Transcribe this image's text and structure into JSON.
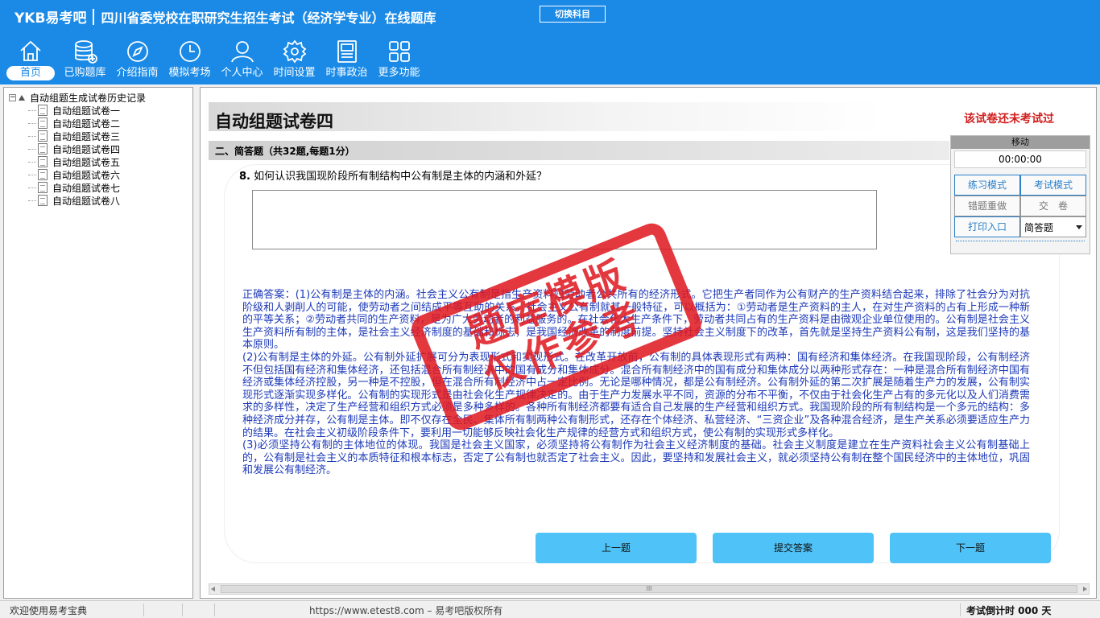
{
  "header": {
    "brand": "YKB易考吧",
    "title": "四川省委党校在职研究生招生考试（经济学专业）在线题库",
    "switch_subject": "切换科目"
  },
  "nav": [
    {
      "label": "首页",
      "icon": "home-icon",
      "active": true
    },
    {
      "label": "已购题库",
      "icon": "database-icon"
    },
    {
      "label": "介绍指南",
      "icon": "compass-icon"
    },
    {
      "label": "模拟考场",
      "icon": "clock-icon"
    },
    {
      "label": "个人中心",
      "icon": "user-icon"
    },
    {
      "label": "时间设置",
      "icon": "gear-icon"
    },
    {
      "label": "时事政治",
      "icon": "document-icon"
    },
    {
      "label": "更多功能",
      "icon": "grid-icon"
    }
  ],
  "sidebar": {
    "root": "自动组题生成试卷历史记录",
    "items": [
      "自动组题试卷一",
      "自动组题试卷二",
      "自动组题试卷三",
      "自动组题试卷四",
      "自动组题试卷五",
      "自动组题试卷六",
      "自动组题试卷七",
      "自动组题试卷八"
    ]
  },
  "paper": {
    "title": "自动组题试卷四",
    "status": "该试卷还未考试过",
    "section": "二、简答题（共32题,每题1分）",
    "question_number": "8.",
    "question": "如何认识我国现阶段所有制结构中公有制是主体的内涵和外延？",
    "answer": [
      "正确答案：(1)公有制是主体的内涵。社会主义公有制是指生产资料归劳动者公共所有的经济形式。它把生产者同作为公有财产的生产资料结合起来，排除了社会分为对抗阶级和人剥削人的可能，使劳动者之间结成平等互助的关系。社会主义公有制就其一般特征，可以概括为：①劳动者是生产资料的主人，在对生产资料的占有上形成一种新的平等关系；②劳动者共同的生产资料，是为广大劳动者的利益服务的。在社会化大生产条件下，劳动者共同占有的生产资料是由微观企业单位使用的。公有制是社会主义生产资料所有制的主体，是社会主义经济制度的基础和标志，是我国经济改革的制度前提。坚持社会主义制度下的改革，首先就是坚持生产资料公有制，这是我们坚持的基本原则。",
      "(2)公有制是主体的外延。公有制外延扩展可分为表现形式和实现形式。在改革开放前，公有制的具体表现形式有两种：国有经济和集体经济。在我国现阶段，公有制经济不但包括国有经济和集体经济，还包括混合所有制经济中的国有成分和集体成分。混合所有制经济中的国有成分和集体成分以两种形式存在：一种是混合所有制经济中国有经济或集体经济控股，另一种是不控股，但在混合所有制经济中占一定比例。无论是哪种情况，都是公有制经济。公有制外延的第二次扩展是随着生产力的发展，公有制实现形式逐渐实现多样化。公有制的实现形式是由社会化生产规律决定的。由于生产力发展水平不同，资源的分布不平衡，不仅由于社会化生产占有的多元化以及人们消费需求的多样性，决定了生产经营和组织方式必须是多种多样的。各种所有制经济都要有适合自己发展的生产经营和组织方式。我国现阶段的所有制结构是一个多元的结构：多种经济成分并存，公有制是主体。即不仅存在全民、集体所有制两种公有制形式，还存在个体经济、私营经济、“三资企业”及各种混合经济，是生产关系必须要适应生产力的结果。在社会主义初级阶段条件下，要利用一切能够反映社会化生产规律的经营方式和组织方式，使公有制的实现形式多样化。",
      "(3)必须坚持公有制的主体地位的体现。我国是社会主义国家，必须坚持将公有制作为社会主义经济制度的基础。社会主义制度是建立在生产资料社会主义公有制基础上的，公有制是社会主义的本质特征和根本标志，否定了公有制也就否定了社会主义。因此，要坚持和发展社会主义，就必须坚持公有制在整个国民经济中的主体地位，巩固和发展公有制经济。"
    ],
    "prev": "上一题",
    "submit": "提交答案",
    "next": "下一题"
  },
  "control": {
    "move": "移动",
    "timer": "00:00:00",
    "practice_mode": "练习模式",
    "exam_mode": "考试模式",
    "redo_wrong": "错题重做",
    "hand_in": "交　卷",
    "print": "打印入口",
    "type_select": "简答题"
  },
  "stamp": {
    "line1": "题库模版",
    "line2": "仅作参考"
  },
  "status": {
    "welcome": "欢迎使用易考宝典",
    "url": "https://www.etest8.com – 易考吧版权所有",
    "countdown": "考试倒计时 000 天"
  },
  "colors": {
    "header_bg": "#1a8ae6",
    "answer_text": "#1c39b8",
    "alert_red": "#d21e1e",
    "button_blue": "#4fc3f7"
  }
}
